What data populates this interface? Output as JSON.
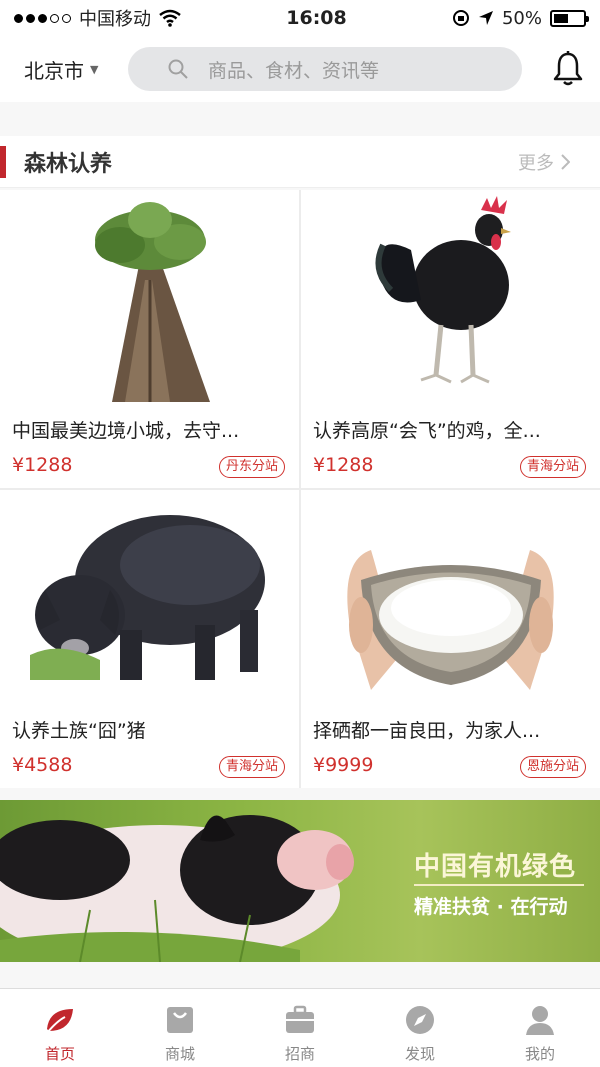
{
  "status_bar": {
    "carrier": "中国移动",
    "time": "16:08",
    "battery": "50%",
    "battery_level": 0.5
  },
  "header": {
    "city": "北京市",
    "search_placeholder": "商品、食材、资讯等"
  },
  "section": {
    "title": "森林认养",
    "more_label": "更多"
  },
  "products": [
    {
      "name": "中国最美边境小城，去守...",
      "price": "¥1288",
      "tag": "丹东分站",
      "image": "tree-image"
    },
    {
      "name": "认养高原“会飞”的鸡，全...",
      "price": "¥1288",
      "tag": "青海分站",
      "image": "rooster-image"
    },
    {
      "name": "认养土族“囧”猪",
      "price": "¥4588",
      "tag": "青海分站",
      "image": "pig-image"
    },
    {
      "name": "择硒都一亩良田，为家人...",
      "price": "¥9999",
      "tag": "恩施分站",
      "image": "rice-bowl-image"
    }
  ],
  "banner": {
    "title": "中国有机绿色",
    "subtitle": "精准扶贫 · 在行动"
  },
  "tabs": [
    {
      "label": "首页",
      "icon": "home-leaf-icon",
      "active": true
    },
    {
      "label": "商城",
      "icon": "shopping-bag-icon",
      "active": false
    },
    {
      "label": "招商",
      "icon": "briefcase-icon",
      "active": false
    },
    {
      "label": "发现",
      "icon": "compass-icon",
      "active": false
    },
    {
      "label": "我的",
      "icon": "user-icon",
      "active": false
    }
  ],
  "colors": {
    "accent": "#c1272d",
    "price": "#d0312d"
  }
}
